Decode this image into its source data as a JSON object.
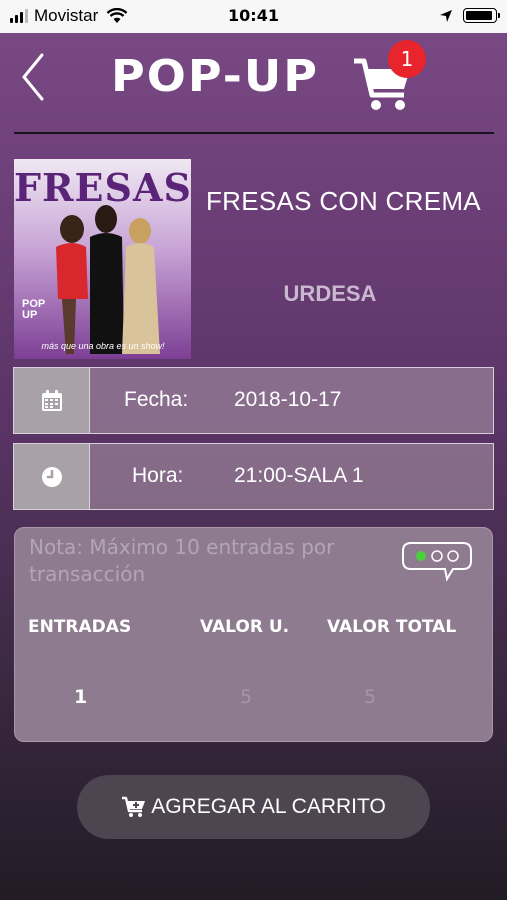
{
  "status_bar": {
    "carrier": "Movistar",
    "time": "10:41"
  },
  "header": {
    "logo": "POP-UP",
    "cart_count": "1"
  },
  "show": {
    "poster_title": "FRESAS",
    "poster_logo_line1": "POP",
    "poster_logo_line2": "UP",
    "poster_tagline": "más que una obra es un show!",
    "title": "FRESAS CON CREMA",
    "venue": "URDESA"
  },
  "details": {
    "date_label": "Fecha:",
    "date_value": "2018-10-17",
    "time_label": "Hora:",
    "time_value": "21:00-SALA 1"
  },
  "tickets": {
    "note": "Nota: Máximo 10 entradas por transacción",
    "col_entradas": "ENTRADAS",
    "col_valor_u": "VALOR U.",
    "col_valor_total": "VALOR TOTAL",
    "entradas": "1",
    "valor_u": "5",
    "valor_total": "5"
  },
  "add_to_cart_label": "AGREGAR AL CARRITO",
  "colors": {
    "badge": "#e8242c",
    "panel": "#8e7b8f",
    "button": "#4d4550"
  }
}
